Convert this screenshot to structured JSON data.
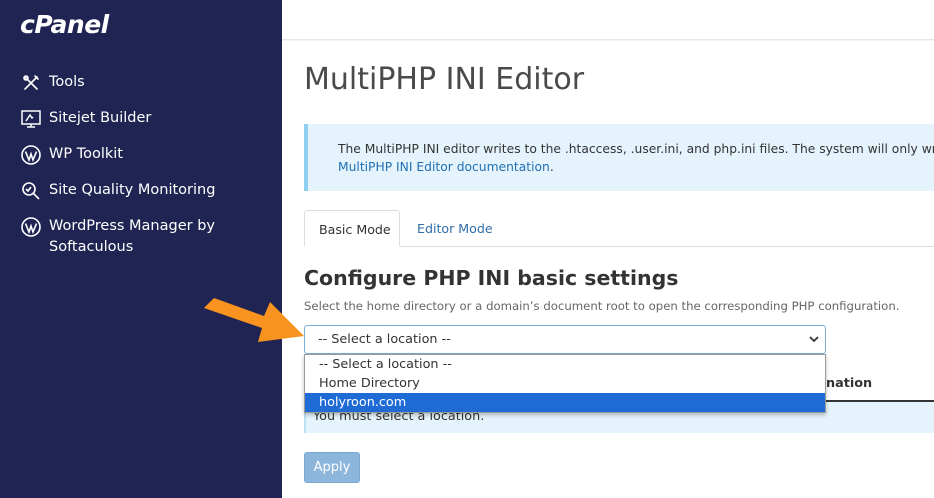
{
  "app": {
    "logo": "cPanel"
  },
  "sidebar": {
    "items": [
      {
        "label": "Tools",
        "icon": "tools-icon"
      },
      {
        "label": "Sitejet Builder",
        "icon": "monitor-icon"
      },
      {
        "label": "WP Toolkit",
        "icon": "wordpress-icon"
      },
      {
        "label": "Site Quality Monitoring",
        "icon": "magnifier-icon"
      },
      {
        "label": "WordPress Manager by",
        "label2": "Softaculous",
        "icon": "wordpress-icon"
      }
    ]
  },
  "page": {
    "title": "MultiPHP INI Editor",
    "info_text": "The MultiPHP INI editor writes to the .htaccess, .user.ini, and php.ini files. The system will only write a d",
    "info_link": "MultiPHP INI Editor documentation",
    "info_suffix": "."
  },
  "tabs": [
    {
      "label": "Basic Mode",
      "active": true
    },
    {
      "label": "Editor Mode",
      "active": false
    }
  ],
  "section": {
    "title": "Configure PHP INI basic settings",
    "description": "Select the home directory or a domain’s document root to open the corresponding PHP configuration."
  },
  "location_select": {
    "value": "-- Select a location --",
    "options": [
      "-- Select a location --",
      "Home Directory",
      "holyroon.com"
    ],
    "highlighted_index": 2
  },
  "table": {
    "partial_header": "nation"
  },
  "alert": {
    "text": "You must select a location."
  },
  "buttons": {
    "apply": "Apply"
  },
  "colors": {
    "sidebar_bg": "#1f2452",
    "link": "#2f6ea8",
    "info_bg": "#e5f4fc",
    "highlight": "#1e6bd6",
    "arrow": "#f7931e",
    "apply_bg": "#8cb6dc"
  }
}
